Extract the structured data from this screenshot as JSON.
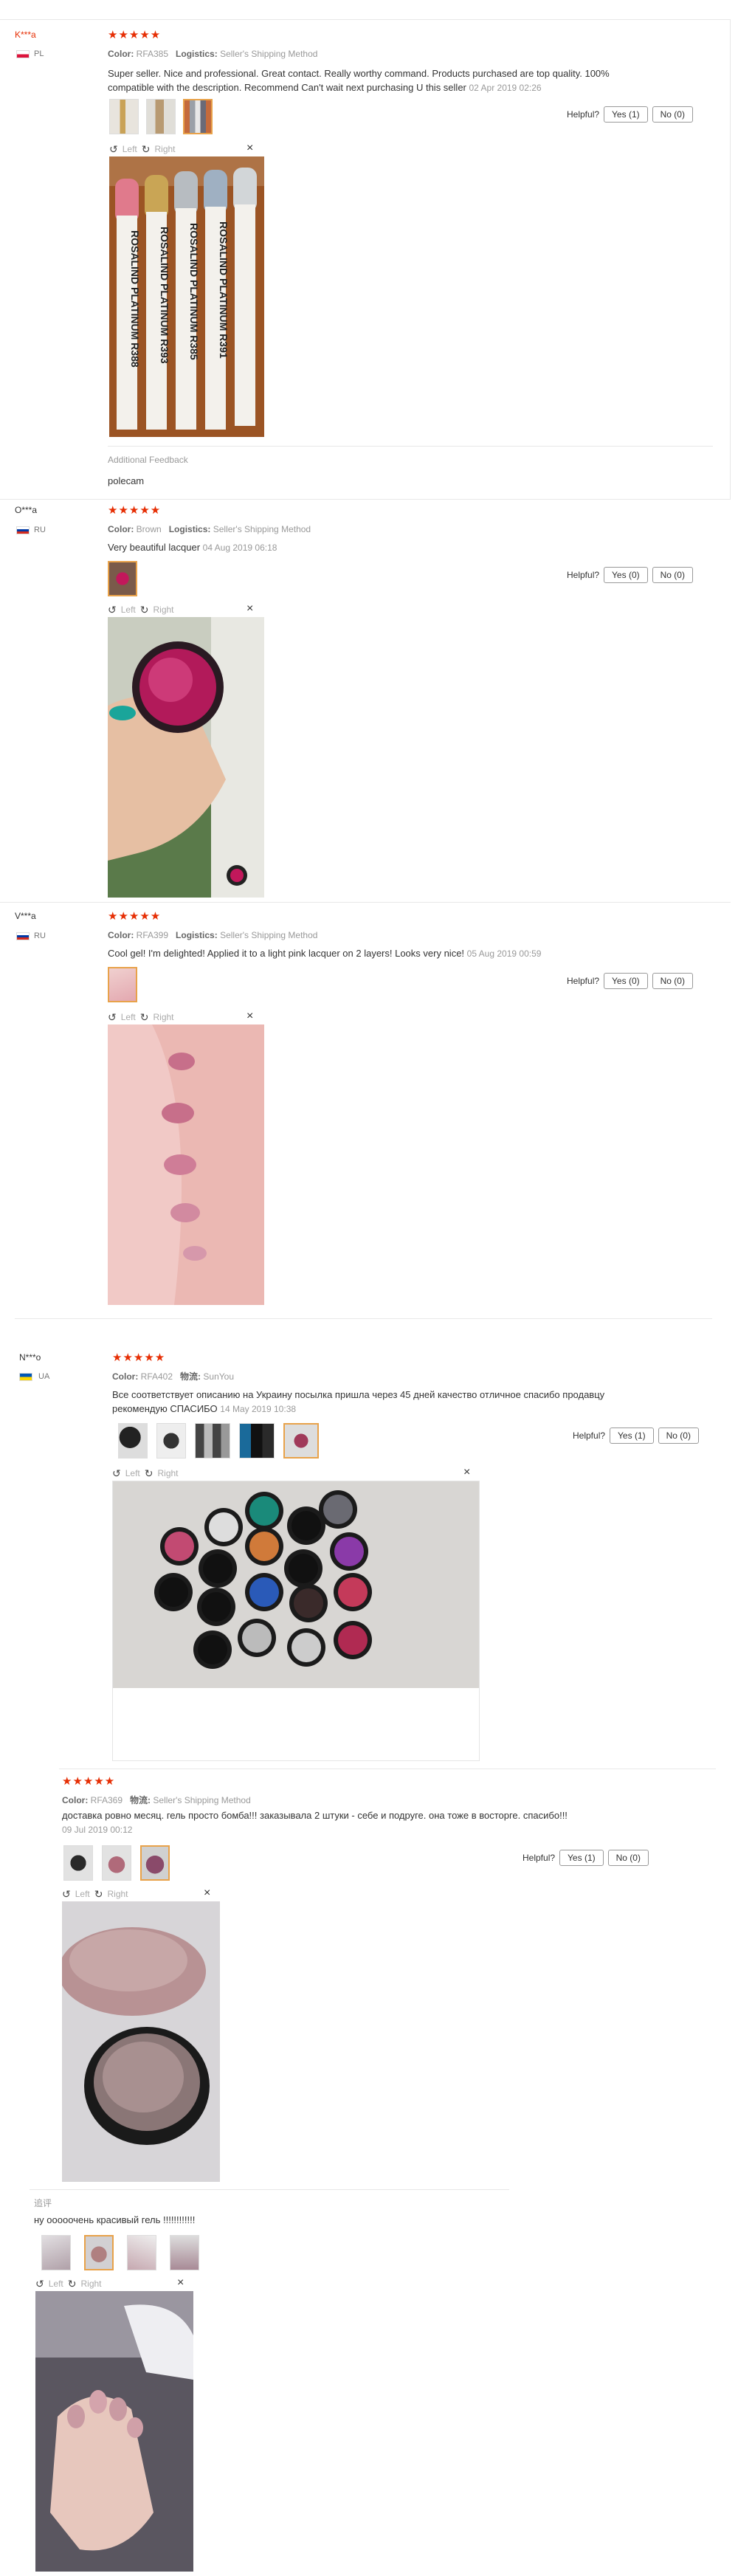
{
  "reviews": [
    {
      "user": "K***a",
      "country": "PL",
      "stars": "★★★★★",
      "color_label": "Color:",
      "color": "RFA385",
      "logistics_label": "Logistics:",
      "logistics": "Seller's Shipping Method",
      "text": "Super seller. Nice and professional. Great contact. Really worthy command. Products purchased are top quality. 100% compatible with the description. Recommend Can't wait next purchasing U this seller",
      "date": "02 Apr 2019 02:26",
      "helpful": "Helpful?",
      "yes": "Yes (1)",
      "no": "No (0)",
      "left": "Left",
      "right": "Right",
      "additional_label": "Additional Feedback",
      "additional_text": "polecam",
      "photo_labels": [
        "ROSALIND PLATINUM R388",
        "ROSALIND PLATINUM R393",
        "ROSALIND PLATINUM R385",
        "ROSALIND PLATINUM R391"
      ]
    },
    {
      "user": "O***a",
      "country": "RU",
      "stars": "★★★★★",
      "color_label": "Color:",
      "color": "Brown",
      "logistics_label": "Logistics:",
      "logistics": "Seller's Shipping Method",
      "text": "Very beautiful lacquer",
      "date": "04 Aug 2019 06:18",
      "helpful": "Helpful?",
      "yes": "Yes (0)",
      "no": "No (0)",
      "left": "Left",
      "right": "Right"
    },
    {
      "user": "V***a",
      "country": "RU",
      "stars": "★★★★★",
      "color_label": "Color:",
      "color": "RFA399",
      "logistics_label": "Logistics:",
      "logistics": "Seller's Shipping Method",
      "text": "Cool gel! I'm delighted! Applied it to a light pink lacquer on 2 layers! Looks very nice!",
      "date": "05 Aug 2019 00:59",
      "helpful": "Helpful?",
      "yes": "Yes (0)",
      "no": "No (0)",
      "left": "Left",
      "right": "Right"
    },
    {
      "user": "N***o",
      "country": "UA",
      "stars": "★★★★★",
      "color_label": "Color:",
      "color": "RFA402",
      "logistics_label": "物流:",
      "logistics": "SunYou",
      "text": "Все соответствует описанию на Украину посылка пришла через 45 дней качество отличное спасибо продавцу рекомендую СПАСИБО",
      "date": "14 May 2019 10:38",
      "helpful": "Helpful?",
      "yes": "Yes (1)",
      "no": "No (0)",
      "left": "Left",
      "right": "Right"
    },
    {
      "stars": "★★★★★",
      "color_label": "Color:",
      "color": "RFA369",
      "logistics_label": "物流:",
      "logistics": "Seller's Shipping Method",
      "text": "доставка ровно месяц. гель просто бомба!!! заказывала 2 штуки - себе и подруге. она тоже в восторге. спасибо!!!",
      "date": "09 Jul 2019 00:12",
      "helpful": "Helpful?",
      "yes": "Yes (1)",
      "no": "No (0)",
      "left": "Left",
      "right": "Right"
    },
    {
      "additional_label": "追评",
      "text": "ну ооооочень красивый гель !!!!!!!!!!!!",
      "left": "Left",
      "right": "Right"
    }
  ],
  "colors": {
    "star": "#e62e04",
    "selected_border": "#e8a24a"
  },
  "icons": {
    "rotate_left": "rotate-left-icon",
    "rotate_right": "rotate-right-icon",
    "close": "close-icon",
    "star": "star-icon"
  }
}
